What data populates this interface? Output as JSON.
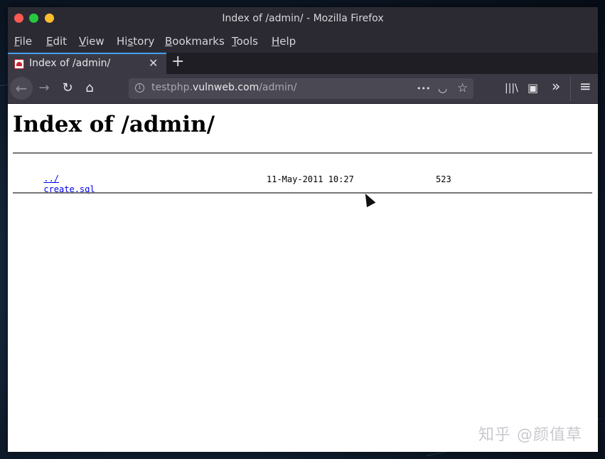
{
  "window": {
    "title": "Index of /admin/ - Mozilla Firefox"
  },
  "menu": [
    {
      "label": "File",
      "mnemonic": "F"
    },
    {
      "label": "Edit",
      "mnemonic": "E"
    },
    {
      "label": "View",
      "mnemonic": "V"
    },
    {
      "label": "History",
      "mnemonic": "s"
    },
    {
      "label": "Bookmarks",
      "mnemonic": "B"
    },
    {
      "label": "Tools",
      "mnemonic": "T"
    },
    {
      "label": "Help",
      "mnemonic": "H"
    }
  ],
  "tab": {
    "title": "Index of /admin/",
    "close_glyph": "✕"
  },
  "newtab_glyph": "+",
  "url": {
    "prefix": "testphp.",
    "host": "vulnweb.com",
    "path": "/admin/"
  },
  "icons": {
    "back": "←",
    "forward": "→",
    "reload": "↻",
    "home": "⌂",
    "more": "•••",
    "pocket": "◡",
    "star": "☆",
    "library": "|||\\",
    "sidebar": "▣",
    "overflow": "»",
    "hamburger": "≡",
    "info": "i"
  },
  "page": {
    "heading": "Index of /admin/",
    "parent_link": "../",
    "files": [
      {
        "name": "create.sql",
        "date": "11-May-2011 10:27",
        "size": "523"
      }
    ]
  },
  "watermark": "知乎 @颜值草",
  "colors": {
    "chrome": "#2b2a33",
    "toolbar": "#3b3a44",
    "tab_accent": "#45a1ff",
    "link": "#0000ee"
  }
}
